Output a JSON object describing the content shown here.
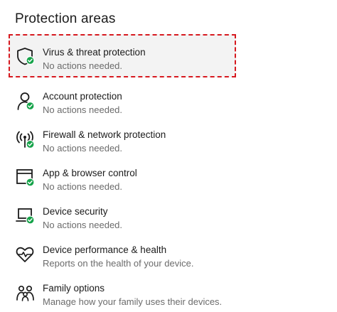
{
  "section": {
    "heading": "Protection areas"
  },
  "items": [
    {
      "title": "Virus & threat protection",
      "status": "No actions needed.",
      "icon": "shield-check-icon"
    },
    {
      "title": "Account protection",
      "status": "No actions needed.",
      "icon": "person-check-icon"
    },
    {
      "title": "Firewall & network protection",
      "status": "No actions needed.",
      "icon": "antenna-check-icon"
    },
    {
      "title": "App & browser control",
      "status": "No actions needed.",
      "icon": "browser-window-check-icon"
    },
    {
      "title": "Device security",
      "status": "No actions needed.",
      "icon": "laptop-check-icon"
    },
    {
      "title": "Device performance & health",
      "status": "Reports on the health of your device.",
      "icon": "heart-pulse-icon"
    },
    {
      "title": "Family options",
      "status": "Manage how your family uses their devices.",
      "icon": "family-icon"
    }
  ],
  "colors": {
    "check_green": "#16a34a",
    "highlight_red": "#d7191f",
    "selected_bg": "#f3f3f3"
  }
}
